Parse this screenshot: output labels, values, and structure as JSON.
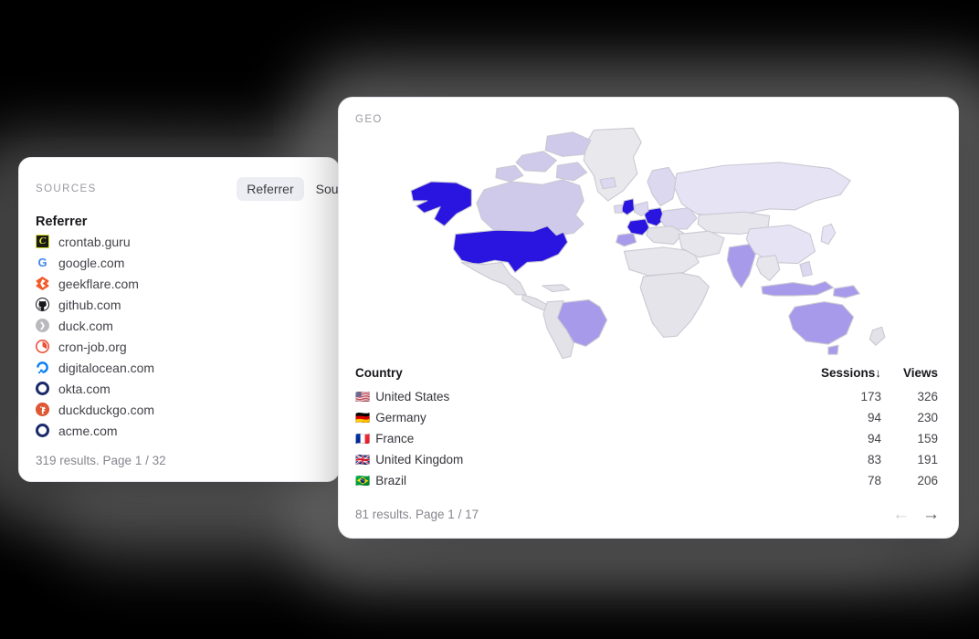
{
  "sources": {
    "title": "SOURCES",
    "tabs": [
      {
        "label": "Referrer",
        "active": true
      },
      {
        "label": "Source",
        "active": false
      }
    ],
    "column_header": "Referrer",
    "items": [
      {
        "label": "crontab.guru",
        "icon": "crontab-favicon",
        "glyph": "C"
      },
      {
        "label": "google.com",
        "icon": "google-favicon",
        "glyph": "G"
      },
      {
        "label": "geekflare.com",
        "icon": "geekflare-favicon",
        "glyph": ""
      },
      {
        "label": "github.com",
        "icon": "github-favicon",
        "glyph": ""
      },
      {
        "label": "duck.com",
        "icon": "duck-favicon",
        "glyph": "❯"
      },
      {
        "label": "cron-job.org",
        "icon": "cronjob-favicon",
        "glyph": ""
      },
      {
        "label": "digitalocean.com",
        "icon": "digitalocean-favicon",
        "glyph": ""
      },
      {
        "label": "okta.com",
        "icon": "okta-favicon",
        "glyph": ""
      },
      {
        "label": "duckduckgo.com",
        "icon": "duckduckgo-favicon",
        "glyph": ""
      },
      {
        "label": "acme.com",
        "icon": "acme-favicon",
        "glyph": ""
      }
    ],
    "footer": "319 results. Page 1 / 32"
  },
  "geo": {
    "title": "GEO",
    "columns": {
      "country": "Country",
      "sessions": "Sessions",
      "sessions_sort": "↓",
      "views": "Views"
    },
    "rows": [
      {
        "flag": "🇺🇸",
        "country": "United States",
        "sessions": "173",
        "views": "326"
      },
      {
        "flag": "🇩🇪",
        "country": "Germany",
        "sessions": "94",
        "views": "230"
      },
      {
        "flag": "🇫🇷",
        "country": "France",
        "sessions": "94",
        "views": "159"
      },
      {
        "flag": "🇬🇧",
        "country": "United Kingdom",
        "sessions": "83",
        "views": "191"
      },
      {
        "flag": "🇧🇷",
        "country": "Brazil",
        "sessions": "78",
        "views": "206"
      }
    ],
    "footer": "81 results. Page 1 / 17",
    "pager": {
      "prev": "←",
      "next": "→"
    }
  },
  "chart_data": {
    "type": "heatmap",
    "title": "GEO",
    "map_projection": "world-choropleth",
    "metric": "Sessions",
    "legend_position": "none",
    "colors": {
      "no_data": "#e9e9ed",
      "level_1": "#e6e4f4",
      "level_2": "#dcd8f0",
      "level_3": "#cfc9ea",
      "level_4": "#a79aea",
      "level_5": "#2a14e0",
      "border": "#c9c9d3",
      "accent": "#2a14e0"
    },
    "countries": [
      {
        "name": "United States",
        "sessions": 173,
        "views": 326,
        "level": 5
      },
      {
        "name": "Germany",
        "sessions": 94,
        "views": 230,
        "level": 5
      },
      {
        "name": "France",
        "sessions": 94,
        "views": 159,
        "level": 5
      },
      {
        "name": "United Kingdom",
        "sessions": 83,
        "views": 191,
        "level": 5
      },
      {
        "name": "Brazil",
        "sessions": 78,
        "views": 206,
        "level": 4
      },
      {
        "name": "Australia",
        "sessions": null,
        "views": null,
        "level": 4
      },
      {
        "name": "India",
        "sessions": null,
        "views": null,
        "level": 4
      },
      {
        "name": "Indonesia",
        "sessions": null,
        "views": null,
        "level": 4
      },
      {
        "name": "Spain",
        "sessions": null,
        "views": null,
        "level": 4
      },
      {
        "name": "Canada",
        "sessions": null,
        "views": null,
        "level": 3
      },
      {
        "name": "Russia",
        "sessions": null,
        "views": null,
        "level": 2
      },
      {
        "name": "Greenland",
        "sessions": null,
        "views": null,
        "level": 0
      }
    ]
  }
}
